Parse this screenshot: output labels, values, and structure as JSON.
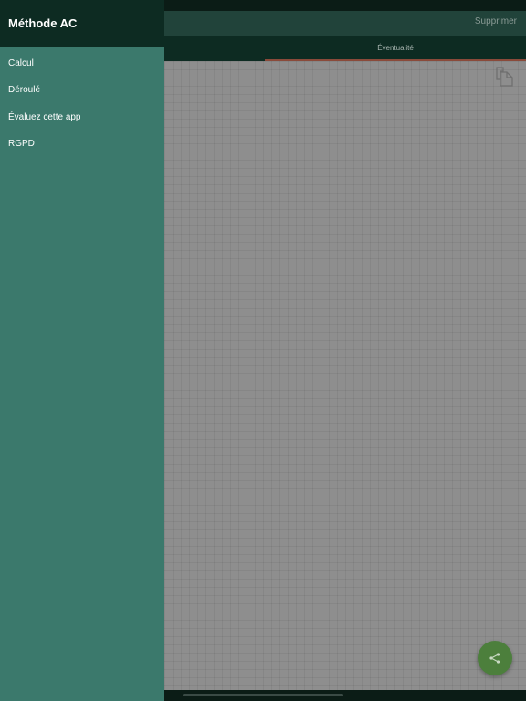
{
  "app_bar": {
    "delete_label": "Supprimer"
  },
  "tabs": [
    {
      "label": "Éventualité",
      "selected": true
    }
  ],
  "drawer": {
    "title": "Méthode AC",
    "items": [
      {
        "label": "Calcul"
      },
      {
        "label": "Déroulé"
      },
      {
        "label": "Évaluez cette app"
      },
      {
        "label": "RGPD"
      }
    ]
  },
  "icons": {
    "copy": "copy-icon",
    "share": "share-icon"
  },
  "colors": {
    "drawer_background": "#3b796c",
    "header_background": "#0d2b22",
    "fab_background": "#4c7f3c",
    "tab_indicator": "#8a4a3a"
  }
}
